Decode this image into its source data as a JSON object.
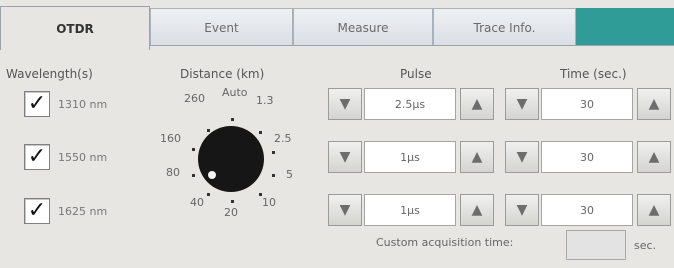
{
  "tabs": [
    "OTDR",
    "Event",
    "Measure",
    "Trace Info."
  ],
  "headers": {
    "wavelengths": "Wavelength(s)",
    "distance": "Distance (km)",
    "pulse": "Pulse",
    "time": "Time (sec.)"
  },
  "wavelength_items": [
    {
      "label": "1310 nm",
      "checked": "✓"
    },
    {
      "label": "1550 nm",
      "checked": "✓"
    },
    {
      "label": "1625 nm",
      "checked": "✓"
    }
  ],
  "distance_dial": {
    "labels": [
      "260",
      "Auto",
      "1.3",
      "160",
      "2.5",
      "80",
      "5",
      "40",
      "20",
      "10"
    ],
    "selected": "80"
  },
  "rows": [
    {
      "pulse": "2.5µs",
      "time": "30"
    },
    {
      "pulse": "1µs",
      "time": "30"
    },
    {
      "pulse": "1µs",
      "time": "30"
    }
  ],
  "controls": {
    "down": "▼",
    "up": "▲"
  },
  "custom_acquisition": {
    "label": "Custom acquisition time:",
    "value": "",
    "unit": "sec."
  }
}
